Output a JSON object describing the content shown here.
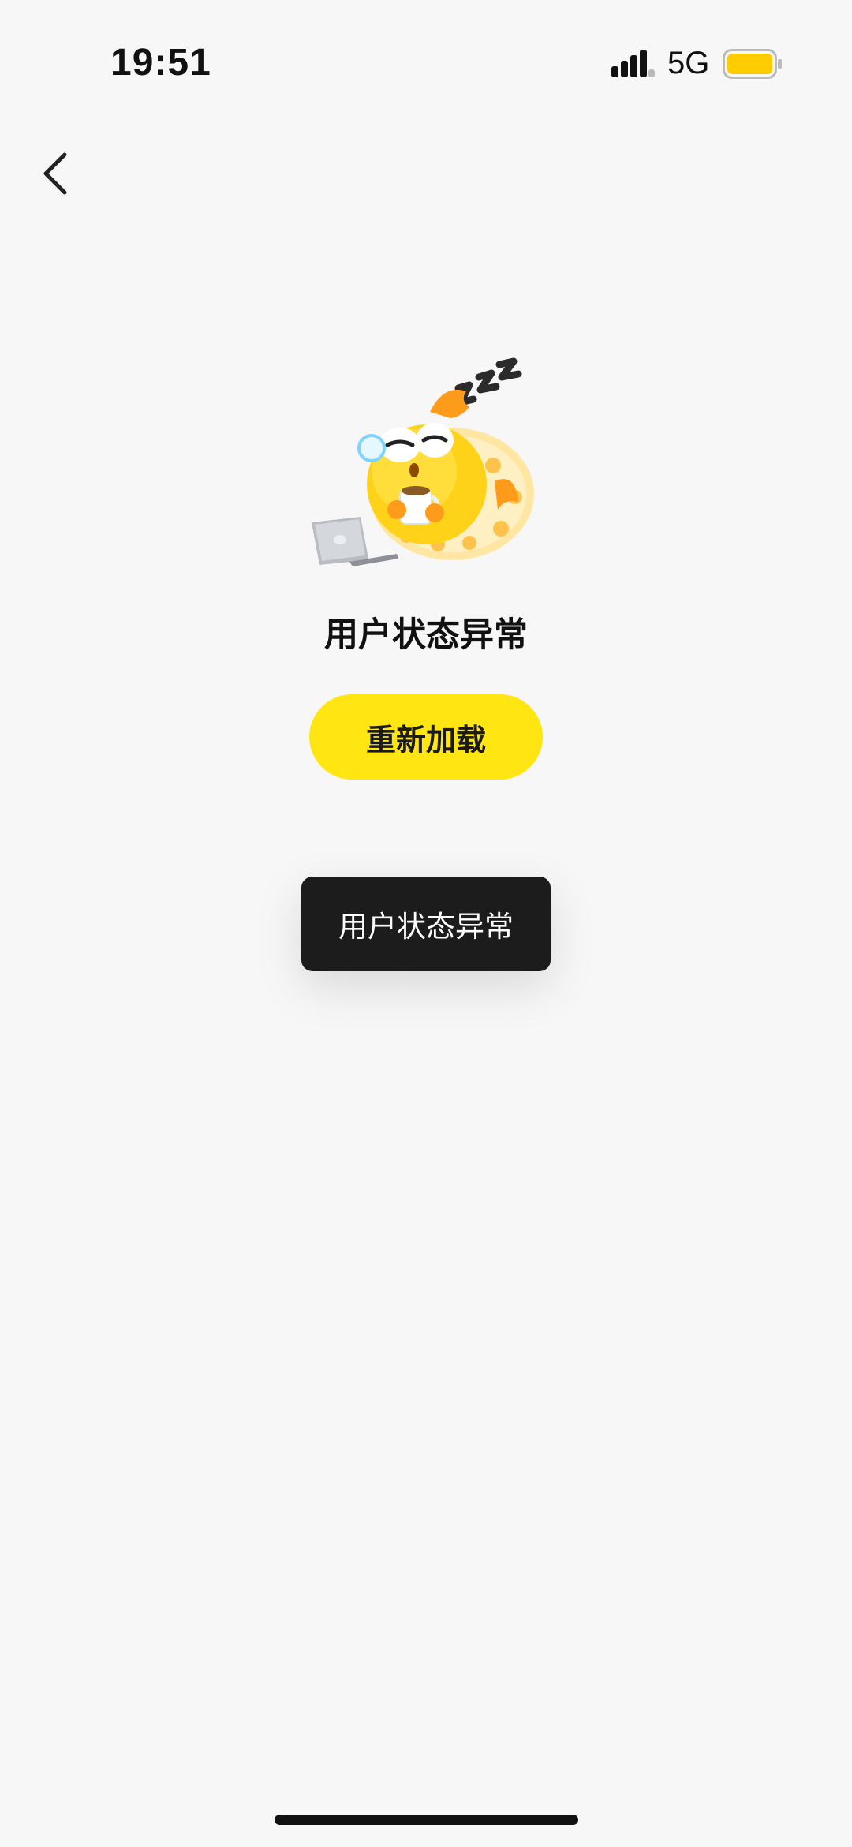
{
  "status_bar": {
    "time": "19:51",
    "network": "5G",
    "battery_color": "#ffcc00"
  },
  "nav": {
    "back_icon": "chevron-left-icon"
  },
  "empty_state": {
    "illustration": "sleeping-yellow-fish-mascot",
    "title": "用户状态异常",
    "reload_label": "重新加载",
    "accent_color": "#ffe512"
  },
  "toast": {
    "message": "用户状态异常"
  }
}
